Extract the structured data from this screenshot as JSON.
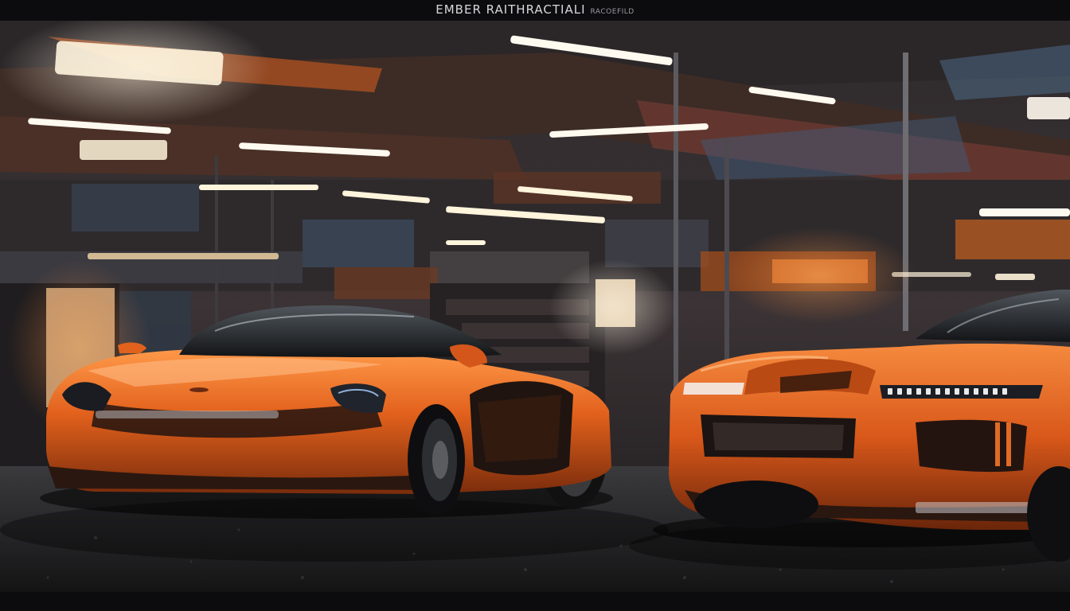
{
  "header": {
    "title": "EMBER RAITHRACTIALI",
    "subtitle": "RACOEFILD"
  },
  "scene": {
    "subject": "two orange sports cars parked in an industrial garage",
    "colors": {
      "car_orange": "#e0621c",
      "floor": "#2a2a2c",
      "ceiling_light": "#fff3dc",
      "background": "#3a3436"
    }
  }
}
